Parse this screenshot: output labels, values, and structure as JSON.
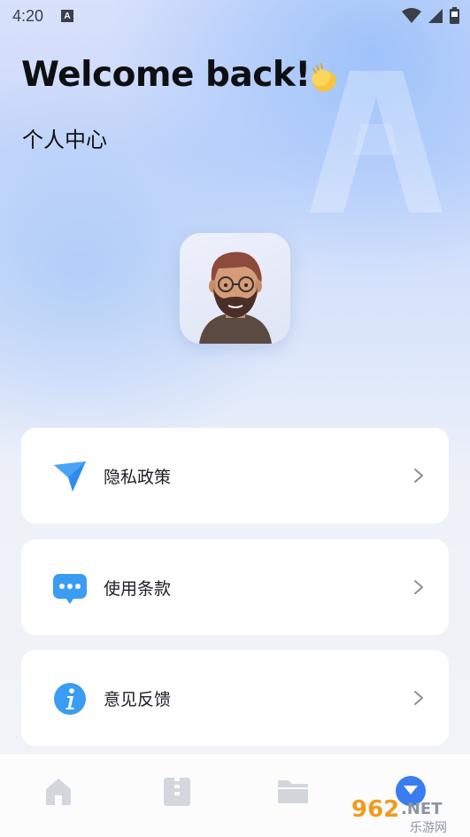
{
  "status_bar": {
    "time": "4:20",
    "notification_icon": "a-box-icon",
    "wifi_icon": "wifi-icon",
    "signal_icon": "signal-icon",
    "battery_icon": "battery-icon"
  },
  "header": {
    "welcome": "Welcome back!",
    "welcome_emoji_icon": "clapping-hands-icon",
    "subtitle": "个人中心"
  },
  "profile": {
    "avatar_icon": "bearded-man-avatar"
  },
  "menu": {
    "items": [
      {
        "label": "隐私政策",
        "icon": "paper-plane-icon",
        "color": "#2f8bf0"
      },
      {
        "label": "使用条款",
        "icon": "chat-bubble-icon",
        "color": "#3a9cf2"
      },
      {
        "label": "意见反馈",
        "icon": "info-icon",
        "color": "#3a9cf2"
      }
    ]
  },
  "bottom_nav": {
    "items": [
      {
        "icon": "home-icon",
        "active": false
      },
      {
        "icon": "archive-icon",
        "active": false
      },
      {
        "icon": "folder-icon",
        "active": false
      },
      {
        "icon": "profile-icon",
        "active": true
      }
    ]
  },
  "watermark": {
    "brand": "962",
    "suffix": ".NET",
    "caption": "乐游网"
  },
  "colors": {
    "accent": "#2f8bf0",
    "nav_inactive": "#d3d6dc",
    "card_bg": "#ffffff"
  }
}
